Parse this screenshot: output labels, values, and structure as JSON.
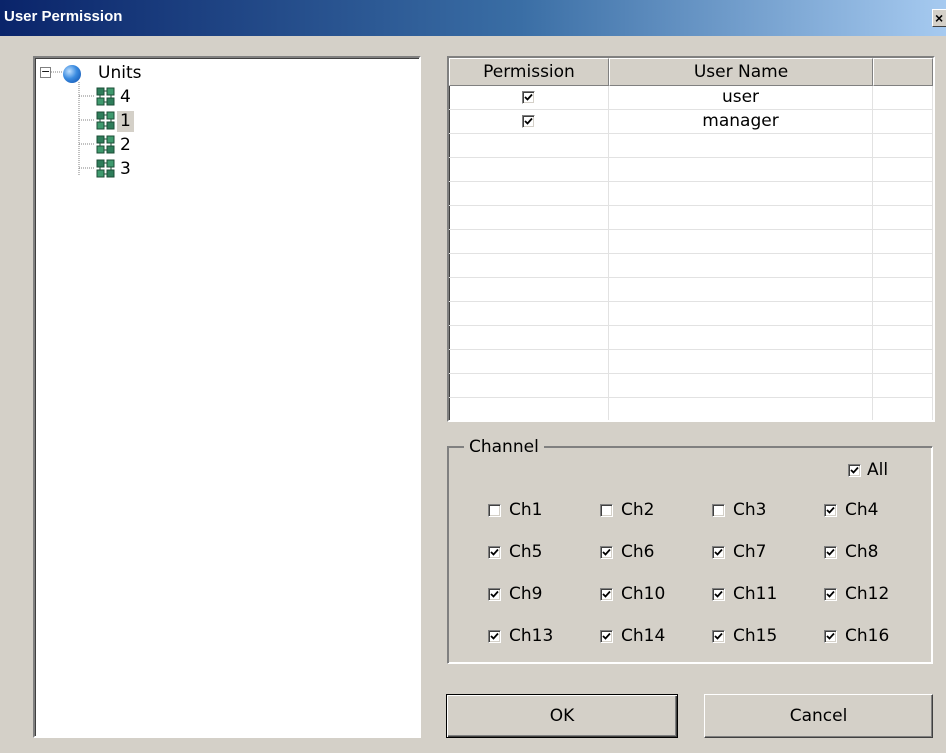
{
  "window": {
    "title": "User Permission",
    "close_glyph": "×"
  },
  "tree": {
    "root_label": "Units",
    "expander_glyph": "−",
    "root_icon": "globe-icon",
    "node_icon": "unit-icon",
    "items": [
      {
        "label": "4",
        "selected": false
      },
      {
        "label": "1",
        "selected": true
      },
      {
        "label": "2",
        "selected": false
      },
      {
        "label": "3",
        "selected": false
      }
    ]
  },
  "grid": {
    "columns": [
      "Permission",
      "User Name",
      ""
    ],
    "rows": [
      {
        "permission": true,
        "user_name": "user"
      },
      {
        "permission": true,
        "user_name": "manager"
      }
    ]
  },
  "channel": {
    "legend": "Channel",
    "all": {
      "label": "All",
      "checked": true
    },
    "channels": [
      {
        "label": "Ch1",
        "checked": false
      },
      {
        "label": "Ch2",
        "checked": false
      },
      {
        "label": "Ch3",
        "checked": false
      },
      {
        "label": "Ch4",
        "checked": true
      },
      {
        "label": "Ch5",
        "checked": true
      },
      {
        "label": "Ch6",
        "checked": true
      },
      {
        "label": "Ch7",
        "checked": true
      },
      {
        "label": "Ch8",
        "checked": true
      },
      {
        "label": "Ch9",
        "checked": true
      },
      {
        "label": "Ch10",
        "checked": true
      },
      {
        "label": "Ch11",
        "checked": true
      },
      {
        "label": "Ch12",
        "checked": true
      },
      {
        "label": "Ch13",
        "checked": true
      },
      {
        "label": "Ch14",
        "checked": true
      },
      {
        "label": "Ch15",
        "checked": true
      },
      {
        "label": "Ch16",
        "checked": true
      }
    ]
  },
  "buttons": {
    "ok": "OK",
    "cancel": "Cancel"
  },
  "colors": {
    "titlebar_start": "#0a246a",
    "titlebar_end": "#a6caf0",
    "face": "#d4d0c8",
    "unit_icon": "#2e7d5a"
  }
}
